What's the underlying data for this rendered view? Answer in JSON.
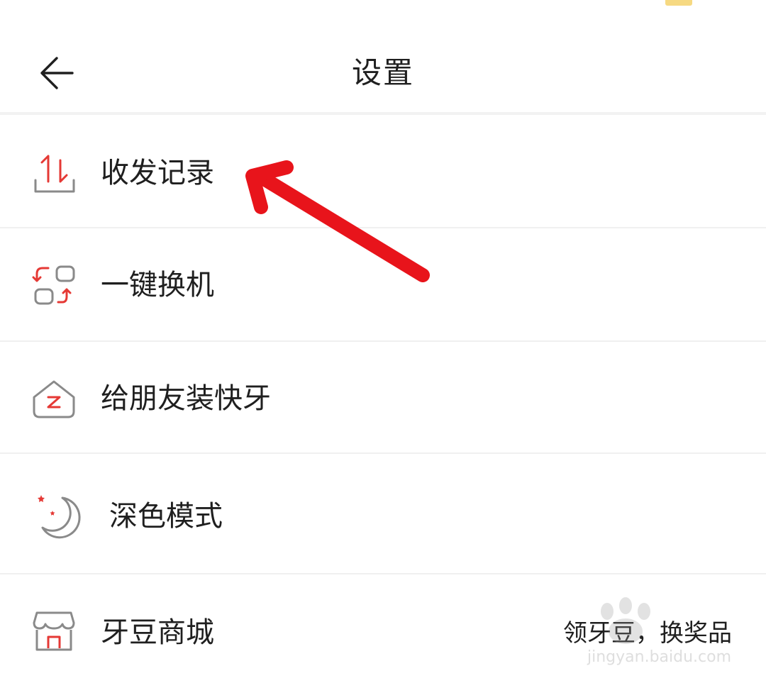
{
  "header": {
    "title": "设置",
    "back_icon": "arrow-left-icon"
  },
  "menu": [
    {
      "id": "send-receive-records",
      "label": "收发记录",
      "icon": "transfer-tray-icon"
    },
    {
      "id": "one-key-switch",
      "label": "一键换机",
      "icon": "device-switch-icon"
    },
    {
      "id": "install-for-friend",
      "label": "给朋友装快牙",
      "icon": "house-z-icon"
    },
    {
      "id": "dark-mode",
      "label": "深色模式",
      "icon": "moon-star-icon"
    },
    {
      "id": "yadou-mall",
      "label": "牙豆商城",
      "icon": "store-icon",
      "hint": "领牙豆，换奖品"
    }
  ],
  "colors": {
    "accent_red": "#e53935",
    "icon_gray": "#8a8a8a",
    "text": "#1f1f1f",
    "divider": "#f0f0f0",
    "annotation_arrow": "#e8141b"
  },
  "watermark": {
    "text": "jingyan.baidu.com"
  }
}
